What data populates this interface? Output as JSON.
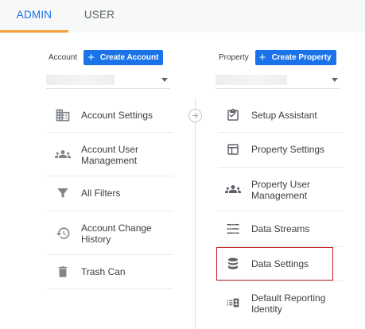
{
  "tabs": [
    {
      "label": "ADMIN",
      "active": true
    },
    {
      "label": "USER",
      "active": false
    }
  ],
  "account": {
    "label": "Account",
    "create_label": "Create Account",
    "selected": ""
  },
  "property": {
    "label": "Property",
    "create_label": "Create Property",
    "selected": ""
  },
  "account_menu": [
    {
      "label": "Account Settings",
      "icon": "building-icon"
    },
    {
      "label": "Account User\nManagement",
      "icon": "people-icon"
    },
    {
      "label": "All Filters",
      "icon": "filter-icon"
    },
    {
      "label": "Account Change\nHistory",
      "icon": "history-icon"
    },
    {
      "label": "Trash Can",
      "icon": "trash-icon"
    }
  ],
  "property_menu": [
    {
      "label": "Setup Assistant",
      "icon": "checklist-icon"
    },
    {
      "label": "Property Settings",
      "icon": "layout-icon"
    },
    {
      "label": "Property User\nManagement",
      "icon": "people-icon"
    },
    {
      "label": "Data Streams",
      "icon": "streams-icon"
    },
    {
      "label": "Data Settings",
      "icon": "database-icon",
      "highlighted": true
    },
    {
      "label": "Default Reporting\nIdentity",
      "icon": "identity-icon"
    }
  ],
  "colors": {
    "accent": "#1a73e8",
    "tab_indicator": "#f2a33a",
    "highlight_border": "#c5221f"
  }
}
